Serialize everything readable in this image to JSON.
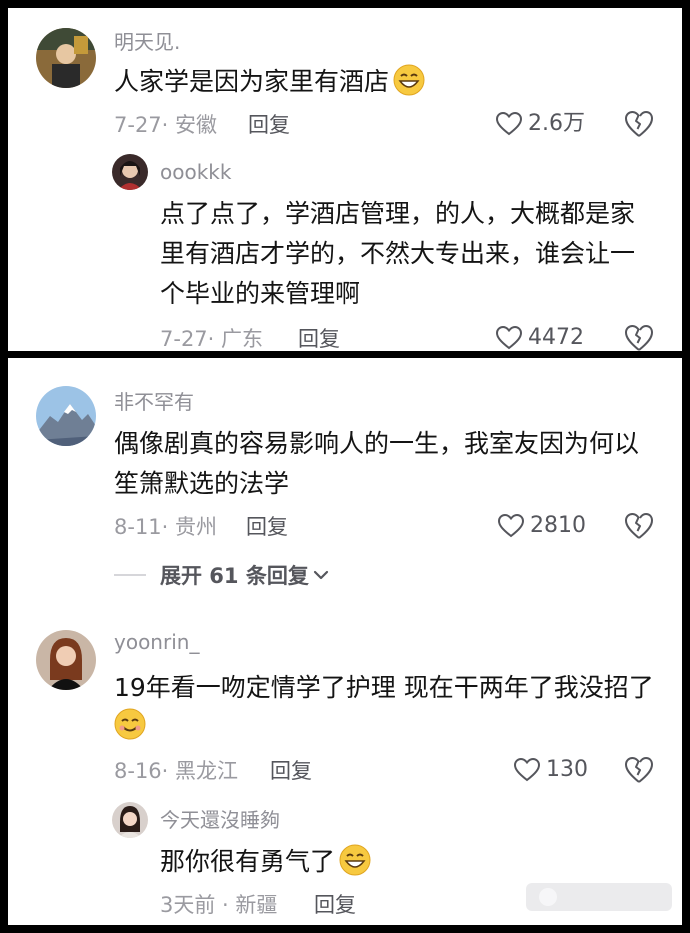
{
  "panel1": {
    "comment": {
      "username": "明天见.",
      "text": "人家学是因为家里有酒店",
      "meta": "7-27· 安徽",
      "reply_label": "回复",
      "likes": "2.6万"
    },
    "reply": {
      "username": "oookkk",
      "text_lines": [
        "点了点了，学酒店管理，的人，大概都是家",
        "里有酒店才学的，不然大专出来，谁会让一",
        "个毕业的来管理啊"
      ],
      "meta": "7-27· 广东",
      "reply_label": "回复",
      "likes": "4472"
    }
  },
  "panel2": {
    "comment1": {
      "username": "非不罕有",
      "text_lines": [
        "偶像剧真的容易影响人的一生，我室友因为何以",
        "笙箫默选的法学"
      ],
      "meta": "8-11· 贵州",
      "reply_label": "回复",
      "likes": "2810",
      "expand_label": "展开 61 条回复"
    },
    "comment2": {
      "username": "yoonrin_",
      "text_lines": [
        "19年看一吻定情学了护理 现在干两年了我没招了"
      ],
      "meta": "8-16· 黑龙江",
      "reply_label": "回复",
      "likes": "130"
    },
    "reply": {
      "username": "今天還沒睡夠",
      "text": "那你很有勇气了",
      "meta": "3天前 · 新疆",
      "reply_label": "回复"
    }
  },
  "colors": {
    "username": "#8f8f96",
    "body_text": "#141414",
    "meta": "#9a9aa0",
    "action": "#55565c"
  },
  "icons": [
    "heart-outline-icon",
    "broken-heart-icon",
    "chevron-down-icon",
    "grin-emoji-icon",
    "smile-emoji-icon"
  ]
}
